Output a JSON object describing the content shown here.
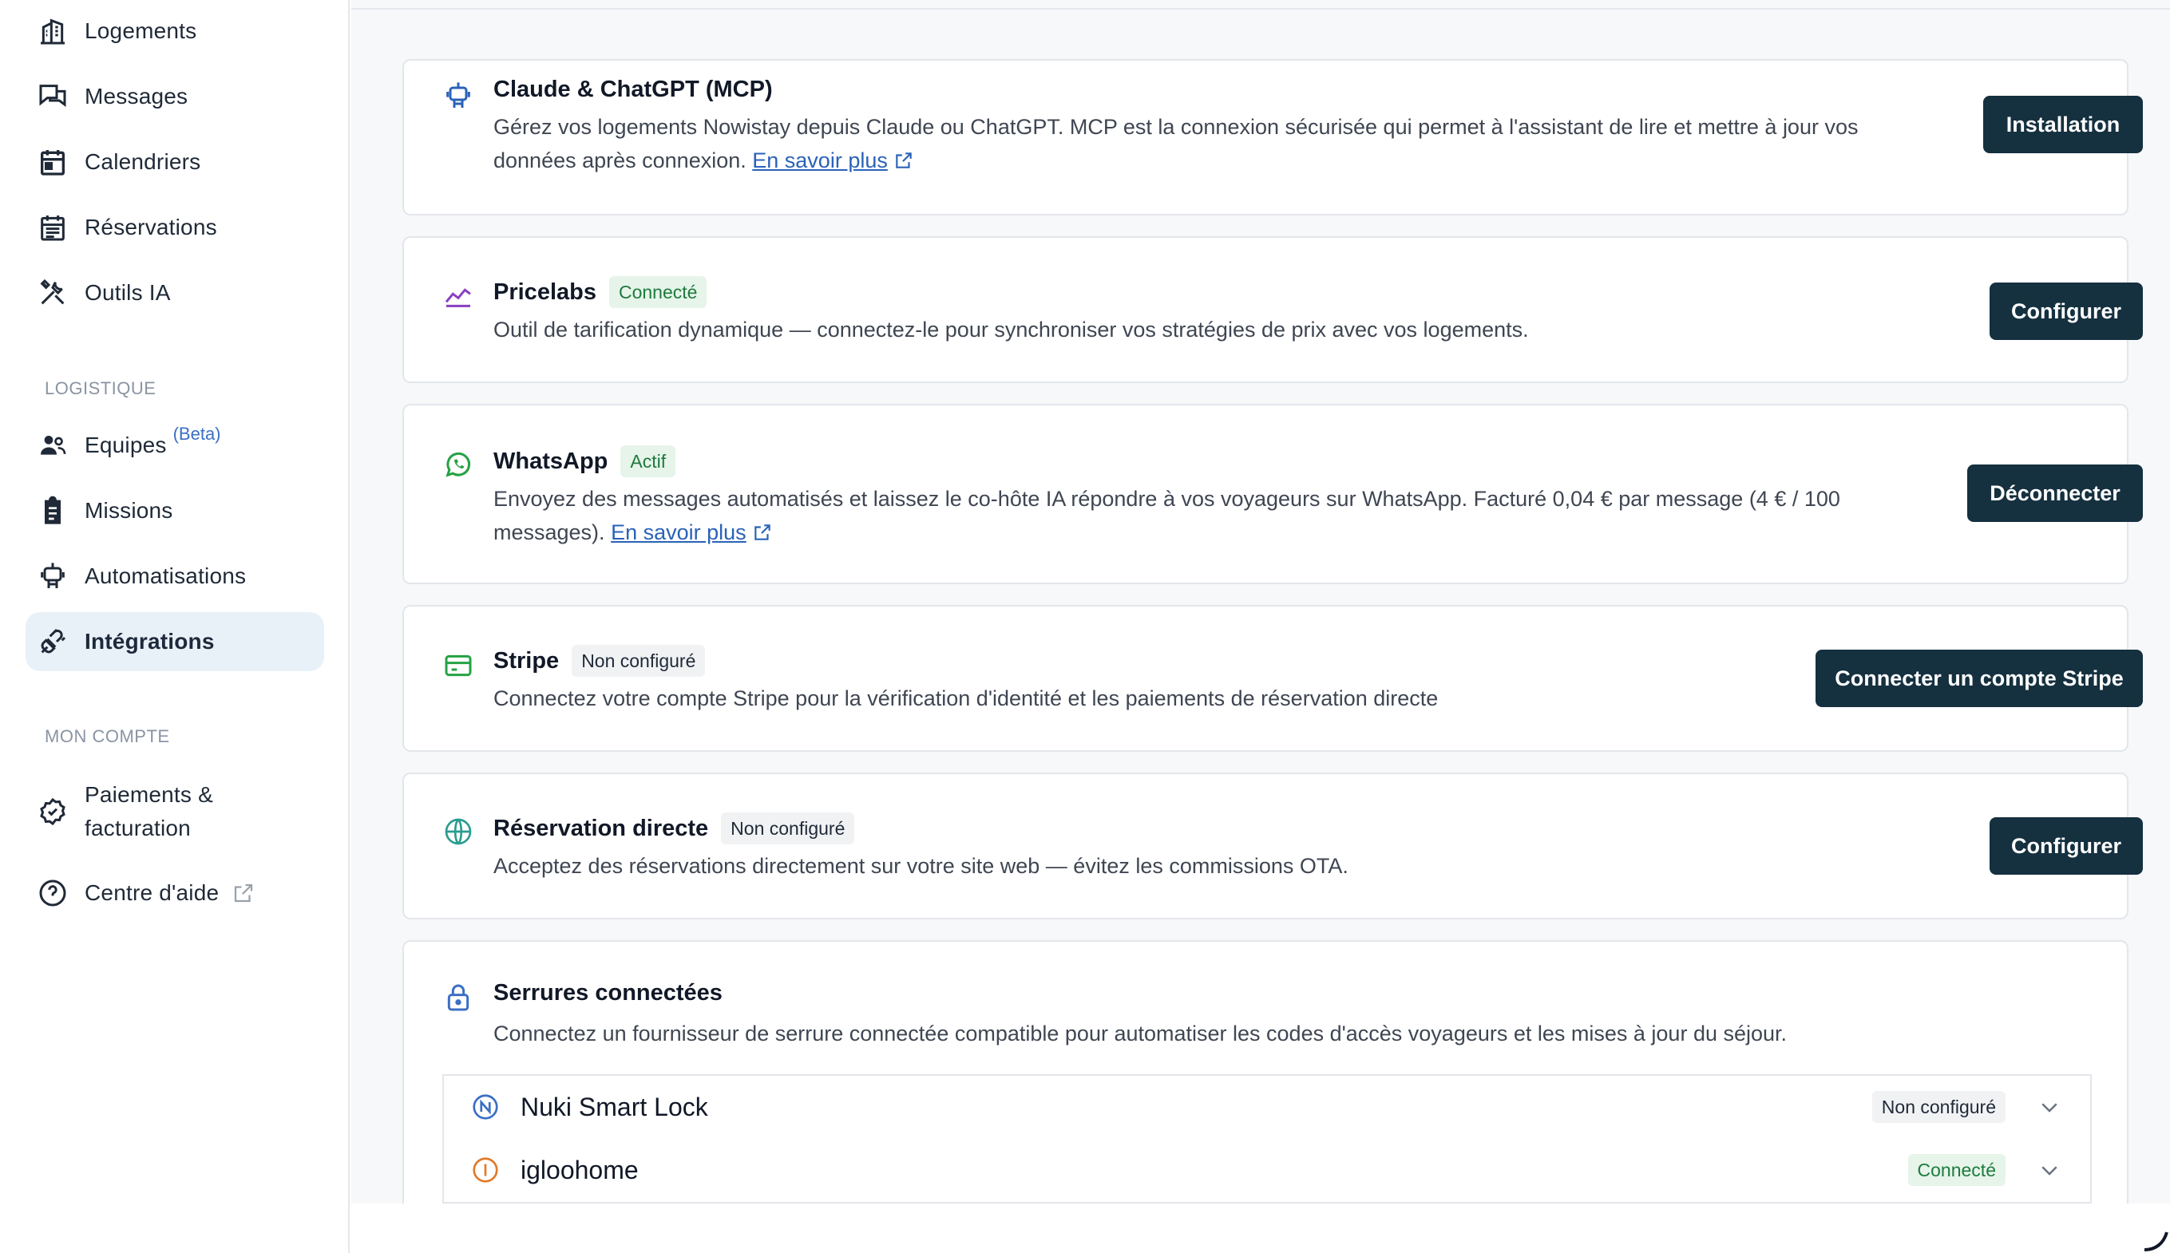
{
  "sidebar": {
    "items": [
      {
        "label": "Logements",
        "icon": "building-icon"
      },
      {
        "label": "Messages",
        "icon": "chat-icon"
      },
      {
        "label": "Calendriers",
        "icon": "calendar-icon"
      },
      {
        "label": "Réservations",
        "icon": "reservation-calendar-icon"
      },
      {
        "label": "Outils IA",
        "icon": "tools-icon"
      }
    ],
    "section_logistique": "LOGISTIQUE",
    "logistique_items": [
      {
        "label": "Equipes",
        "badge": "(Beta)",
        "icon": "team-icon"
      },
      {
        "label": "Missions",
        "icon": "clipboard-icon"
      },
      {
        "label": "Automatisations",
        "icon": "robot-icon"
      },
      {
        "label": "Intégrations",
        "icon": "plug-icon",
        "active": true
      }
    ],
    "section_compte": "MON COMPTE",
    "compte_items": [
      {
        "label_line1": "Paiements &",
        "label_line2": "facturation",
        "icon": "billing-icon"
      },
      {
        "label": "Centre d'aide",
        "icon": "help-icon"
      }
    ]
  },
  "integrations": {
    "mcp": {
      "title": "Claude & ChatGPT (MCP)",
      "desc_line1": "Gérez vos logements Nowistay depuis Claude ou ChatGPT. MCP est la connexion sécurisée qui permet à l'assistant de lire et mettre à jour vos",
      "desc_line2": "données après connexion.",
      "link": "En savoir plus",
      "button": "Installation"
    },
    "pricelabs": {
      "title": "Pricelabs",
      "badge": "Connecté",
      "desc": "Outil de tarification dynamique — connectez-le pour synchroniser vos stratégies de prix avec vos logements.",
      "button": "Configurer"
    },
    "whatsapp": {
      "title": "WhatsApp",
      "badge": "Actif",
      "desc_line1": "Envoyez des messages automatisés et laissez le co-hôte IA répondre à vos voyageurs sur WhatsApp. Facturé 0,04 € par message (4 € / 100",
      "desc_line2": "messages).",
      "link": "En savoir plus",
      "button": "Déconnecter"
    },
    "stripe": {
      "title": "Stripe",
      "badge": "Non configuré",
      "desc": "Connectez votre compte Stripe pour la vérification d'identité et les paiements de réservation directe",
      "button": "Connecter un compte Stripe"
    },
    "direct": {
      "title": "Réservation directe",
      "badge": "Non configuré",
      "desc": "Acceptez des réservations directement sur votre site web — évitez les commissions OTA.",
      "button": "Configurer"
    },
    "locks": {
      "title": "Serrures connectées",
      "desc": "Connectez un fournisseur de serrure connectée compatible pour automatiser les codes d'accès voyageurs et les mises à jour du séjour.",
      "providers": [
        {
          "name": "Nuki Smart Lock",
          "status": "Non configuré",
          "color": "#3b6fc4"
        },
        {
          "name": "igloohome",
          "status": "Connecté",
          "color": "#e07b2a"
        }
      ]
    }
  },
  "colors": {
    "button_bg": "#15303f",
    "badge_green_bg": "#e6f4ea",
    "badge_green_text": "#1e7b3d",
    "active_nav_bg": "#e8f1f8",
    "link": "#2a62b8"
  }
}
